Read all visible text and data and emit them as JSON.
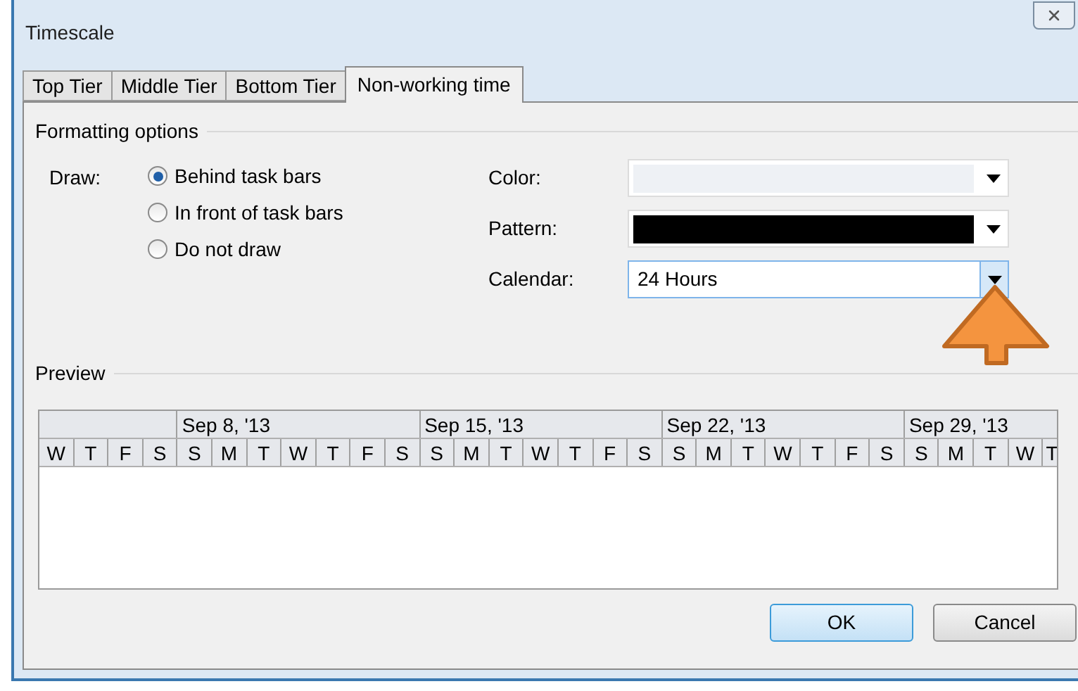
{
  "window": {
    "title": "Timescale"
  },
  "tabs": [
    {
      "label": "Top Tier",
      "selected": false
    },
    {
      "label": "Middle Tier",
      "selected": false
    },
    {
      "label": "Bottom Tier",
      "selected": false
    },
    {
      "label": "Non-working time",
      "selected": true
    }
  ],
  "formatting_options": {
    "title": "Formatting options",
    "draw_label": "Draw:",
    "draw_options": [
      {
        "label": "Behind task bars",
        "selected": true
      },
      {
        "label": "In front of task bars",
        "selected": false
      },
      {
        "label": "Do not draw",
        "selected": false
      }
    ],
    "fields": [
      {
        "label": "Color:",
        "kind": "swatch",
        "color": "#eef1f5",
        "focused": false
      },
      {
        "label": "Pattern:",
        "kind": "swatch",
        "color": "#000000",
        "focused": false
      },
      {
        "label": "Calendar:",
        "kind": "text",
        "value": "24 Hours",
        "focused": true
      }
    ]
  },
  "preview": {
    "title": "Preview",
    "leading_days": [
      "W",
      "T",
      "F",
      "S"
    ],
    "weeks": [
      {
        "label": "Sep 8, '13",
        "days": [
          "S",
          "M",
          "T",
          "W",
          "T",
          "F",
          "S"
        ]
      },
      {
        "label": "Sep 15, '13",
        "days": [
          "S",
          "M",
          "T",
          "W",
          "T",
          "F",
          "S"
        ]
      },
      {
        "label": "Sep 22, '13",
        "days": [
          "S",
          "M",
          "T",
          "W",
          "T",
          "F",
          "S"
        ]
      },
      {
        "label": "Sep 29, '13",
        "days": [
          "S",
          "M",
          "T",
          "W",
          "T"
        ]
      }
    ]
  },
  "buttons": [
    {
      "label": "OK",
      "default": true
    },
    {
      "label": "Cancel",
      "default": false
    }
  ]
}
